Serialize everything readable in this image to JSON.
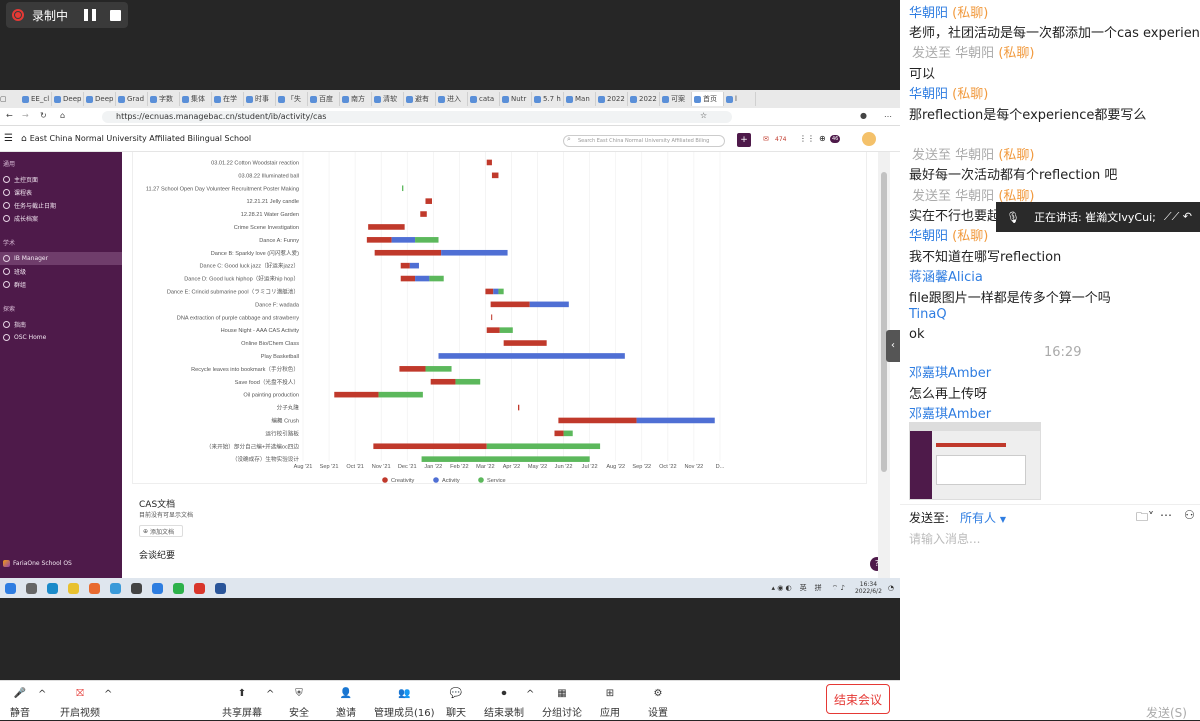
{
  "recording": {
    "label": "录制中"
  },
  "browser": {
    "tabs": [
      "EE_cl",
      "Deep",
      "Deep",
      "Grad",
      "字数",
      "集体",
      "在学",
      "时事",
      "「失",
      "百度",
      "南方",
      "清软",
      "避有",
      "进入",
      "cata",
      "Nutr",
      "5.7 h",
      "Man",
      "2022",
      "2022",
      "可案",
      "首页",
      "l"
    ],
    "url": "https://ecnuas.managebac.cn/student/ib/activity/cas"
  },
  "app": {
    "school": "East China Normal University Affiliated Bilingual School",
    "search_placeholder": "Search East China Normal University Affiliated Biling",
    "mail_count": "474",
    "cas_count": "46",
    "avatar": "🙂"
  },
  "sidebar": {
    "sec1": "通用",
    "items1": [
      "主控页面",
      "课程表",
      "任务与截止日期",
      "成长档案"
    ],
    "sec2": "学术",
    "items2": [
      "IB Manager",
      "班级",
      "群组"
    ],
    "sec3": "探索",
    "items3": [
      "指南",
      "OSC Home"
    ],
    "footer": "FariaOne School OS"
  },
  "colors": {
    "creativity": "#c0392b",
    "activity": "#4f6fd4",
    "service": "#5cb85c",
    "sidebar": "#4e1a4a"
  },
  "chart_data": {
    "type": "gantt",
    "title": "",
    "x_ticks": [
      "Aug '21",
      "Sep '21",
      "Oct '21",
      "Nov '21",
      "Dec '21",
      "Jan '22",
      "Feb '22",
      "Mar '22",
      "Apr '22",
      "May '22",
      "Jun '22",
      "Jul '22",
      "Aug '22",
      "Sep '22",
      "Oct '22",
      "Nov '22",
      "D..."
    ],
    "x_range": [
      0,
      16.5
    ],
    "legend": [
      "Creativity",
      "Activity",
      "Service"
    ],
    "rows": [
      {
        "label": "03.01.22 Cotton Woodstair reaction",
        "segs": [
          [
            7.05,
            7.25,
            0
          ]
        ]
      },
      {
        "label": "03.08.22 Illuminated ball",
        "segs": [
          [
            7.25,
            7.5,
            0
          ]
        ]
      },
      {
        "label": "11.27 School Open Day Volunteer Recruitment Poster Making",
        "segs": [
          [
            3.8,
            3.85,
            2
          ]
        ]
      },
      {
        "label": "12.21.21 Jelly candle",
        "segs": [
          [
            4.7,
            4.95,
            0
          ]
        ]
      },
      {
        "label": "12.28.21 Water Garden",
        "segs": [
          [
            4.5,
            4.75,
            0
          ]
        ]
      },
      {
        "label": "Crime Scene Investigation",
        "segs": [
          [
            2.5,
            3.9,
            0
          ]
        ]
      },
      {
        "label": "Dance A: Funny",
        "segs": [
          [
            2.45,
            3.4,
            0
          ],
          [
            3.4,
            4.3,
            1
          ],
          [
            4.3,
            5.2,
            2
          ]
        ]
      },
      {
        "label": "Dance B: Sparkly love (闪闪惹人爱)",
        "segs": [
          [
            2.75,
            5.3,
            0
          ],
          [
            5.3,
            7.85,
            1
          ]
        ]
      },
      {
        "label": "Dance C: Good luck jazz（好运来jazz）",
        "segs": [
          [
            3.75,
            4.1,
            0
          ],
          [
            4.1,
            4.45,
            1
          ]
        ]
      },
      {
        "label": "Dance D: Good luck hiphop（好运来hip hop）",
        "segs": [
          [
            3.75,
            4.3,
            0
          ],
          [
            4.3,
            4.85,
            1
          ],
          [
            4.85,
            5.4,
            2
          ]
        ]
      },
      {
        "label": "Dance E: Crincid submarine pool（ラミコリ潜艇池）",
        "segs": [
          [
            7.0,
            7.3,
            0
          ],
          [
            7.3,
            7.5,
            1
          ],
          [
            7.5,
            7.7,
            2
          ]
        ]
      },
      {
        "label": "Dance F: wadada",
        "segs": [
          [
            7.2,
            8.7,
            0
          ],
          [
            8.7,
            10.2,
            1
          ]
        ]
      },
      {
        "label": "DNA extraction of purple cabbage and strawberry",
        "segs": [
          [
            7.22,
            7.26,
            0
          ]
        ]
      },
      {
        "label": "House Night - AAA CAS Activity",
        "segs": [
          [
            7.05,
            7.55,
            0
          ],
          [
            7.55,
            8.05,
            2
          ]
        ]
      },
      {
        "label": "Online Bio/Chem Class",
        "segs": [
          [
            7.7,
            9.35,
            0
          ]
        ]
      },
      {
        "label": "Play Basketball",
        "segs": [
          [
            5.2,
            12.35,
            1
          ]
        ]
      },
      {
        "label": "Recycle leaves into bookmark（手分秋色）",
        "segs": [
          [
            3.7,
            4.7,
            0
          ],
          [
            4.7,
            5.7,
            2
          ]
        ]
      },
      {
        "label": "Save food（光盘不投人）",
        "segs": [
          [
            4.9,
            5.85,
            0
          ],
          [
            5.85,
            6.8,
            2
          ]
        ]
      },
      {
        "label": "Oil painting production",
        "segs": [
          [
            1.2,
            2.9,
            0
          ],
          [
            2.9,
            4.6,
            2
          ]
        ]
      },
      {
        "label": "分子丸隆",
        "segs": [
          [
            8.25,
            8.3,
            0
          ]
        ]
      },
      {
        "label": "编舞 Crush",
        "segs": [
          [
            9.8,
            12.8,
            0
          ],
          [
            12.8,
            15.8,
            1
          ]
        ]
      },
      {
        "label": "运行校引路板",
        "segs": [
          [
            9.65,
            10.0,
            0
          ],
          [
            10.0,
            10.35,
            2
          ]
        ]
      },
      {
        "label": "（来开始）部分自己编+并选编oc四边",
        "segs": [
          [
            2.7,
            7.05,
            0
          ],
          [
            7.05,
            11.4,
            2
          ]
        ]
      },
      {
        "label": "（没确成存）生物实验设计",
        "segs": [
          [
            4.55,
            11.0,
            2
          ]
        ]
      }
    ]
  },
  "cas": {
    "doc_title": "CAS文档",
    "no_docs": "目前没有可显示文档",
    "add_doc": "添加文档",
    "meetings": "会谈纪要"
  },
  "taskbar": {
    "lang1": "英",
    "lang2": "拼",
    "time": "16:34",
    "date": "2022/6/2"
  },
  "chat": {
    "messages": [
      {
        "t": "name",
        "text": "华朝阳",
        "priv": "(私聊)"
      },
      {
        "t": "msg",
        "text": "老师，社团活动是每一次都添加一个cas experience吗"
      },
      {
        "t": "sent",
        "text": "发送至",
        "to": "华朝阳",
        "priv": "(私聊)"
      },
      {
        "t": "msg",
        "text": "可以"
      },
      {
        "t": "name",
        "text": "华朝阳",
        "priv": "(私聊)"
      },
      {
        "t": "msg",
        "text": "那reflection是每个experience都要写么"
      },
      {
        "t": "sent",
        "text": "发送至",
        "to": "华朝阳",
        "priv": "(私聊)"
      },
      {
        "t": "msg",
        "text": "最好每一次活动都有个reflection 吧"
      },
      {
        "t": "sent",
        "text": "发送至",
        "to": "华朝阳",
        "priv": "(私聊)"
      },
      {
        "t": "msg",
        "text": "实在不行也要起码"
      },
      {
        "t": "name",
        "text": "华朝阳",
        "priv": "(私聊)"
      },
      {
        "t": "msg",
        "text": "我不知道在哪写reflection"
      },
      {
        "t": "name",
        "text": "蒋涵馨Alicia",
        "priv": ""
      },
      {
        "t": "msg",
        "text": "file跟图片一样都是传多个算一个吗"
      },
      {
        "t": "name",
        "text": "TinaQ",
        "priv": ""
      },
      {
        "t": "msg",
        "text": "ok"
      },
      {
        "t": "time",
        "text": "16:29"
      },
      {
        "t": "name",
        "text": "邓嘉琪Amber",
        "priv": ""
      },
      {
        "t": "msg",
        "text": "怎么再上传呀"
      },
      {
        "t": "name",
        "text": "邓嘉琪Amber",
        "priv": ""
      }
    ],
    "speaking": "正在讲话: 崔瀚文IvyCui;",
    "send_to_label": "发送至:",
    "send_to_value": "所有人",
    "input_placeholder": "请输入消息...",
    "send_btn": "发送(S)"
  },
  "toolbar": {
    "mute": "静音",
    "video": "开启视频",
    "share": "共享屏幕",
    "security": "安全",
    "invite": "邀请",
    "members": "管理成员(16)",
    "chat": "聊天",
    "end_rec": "结束录制",
    "breakout": "分组讨论",
    "apps": "应用",
    "settings": "设置",
    "end_meeting": "结束会议"
  }
}
